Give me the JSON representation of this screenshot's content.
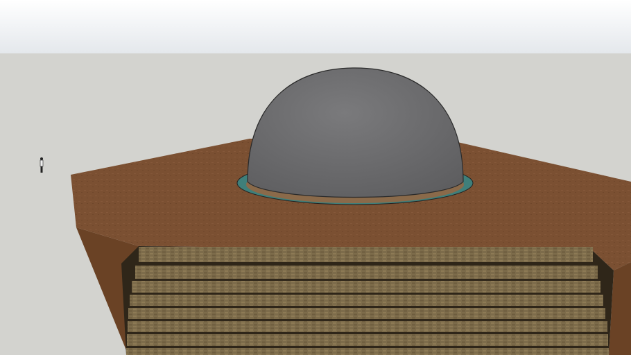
{
  "scene": {
    "colors": {
      "sky_top": "#ffffff",
      "sky_bottom": "#e4e8ec",
      "ground": "#d3d3cf",
      "platform_top": "#7b5032",
      "platform_side": "#6a4225",
      "dome": "#6e6e70",
      "dome_edge": "#2a2a2a",
      "water_ring": "#3f7f7a",
      "step_face": "#7a6a4a",
      "step_shadow": "#2f2619"
    },
    "steps_count": 8
  }
}
